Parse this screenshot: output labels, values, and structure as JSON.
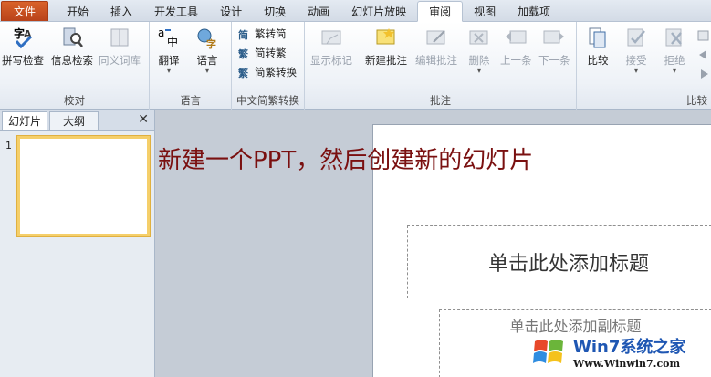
{
  "tabs": [
    "文件",
    "开始",
    "插入",
    "开发工具",
    "设计",
    "切换",
    "动画",
    "幻灯片放映",
    "审阅",
    "视图",
    "加载项"
  ],
  "active_tab": "审阅",
  "ribbon": {
    "proofing": {
      "label": "校对",
      "spell": "拼写检查",
      "research": "信息检索",
      "thesaurus": "同义词库"
    },
    "language": {
      "label": "语言",
      "translate": "翻译",
      "language": "语言"
    },
    "chinese": {
      "label": "中文简繁转换",
      "to_trad": "繁转简",
      "to_simp": "简转繁",
      "convert": "简繁转换"
    },
    "comments": {
      "label": "批注",
      "show": "显示标记",
      "new": "新建批注",
      "edit": "编辑批注",
      "delete": "删除",
      "prev": "上一条",
      "next": "下一条"
    },
    "compare": {
      "label": "比较",
      "compare": "比较",
      "accept": "接受",
      "reject": "拒绝"
    }
  },
  "pane": {
    "tab_slides": "幻灯片",
    "tab_outline": "大纲",
    "close": "✕",
    "slide_number": "1"
  },
  "slide": {
    "title_placeholder": "单击此处添加标题",
    "subtitle_placeholder": "单击此处添加副标题"
  },
  "annotation": "新建一个PPT，然后创建新的幻灯片",
  "watermark": {
    "title": "Win7系统之家",
    "url": "Www.Winwin7.com"
  },
  "colors": {
    "file_tab": "#c9501f",
    "annotation": "#7a1010",
    "selection": "#f5cf6a"
  }
}
